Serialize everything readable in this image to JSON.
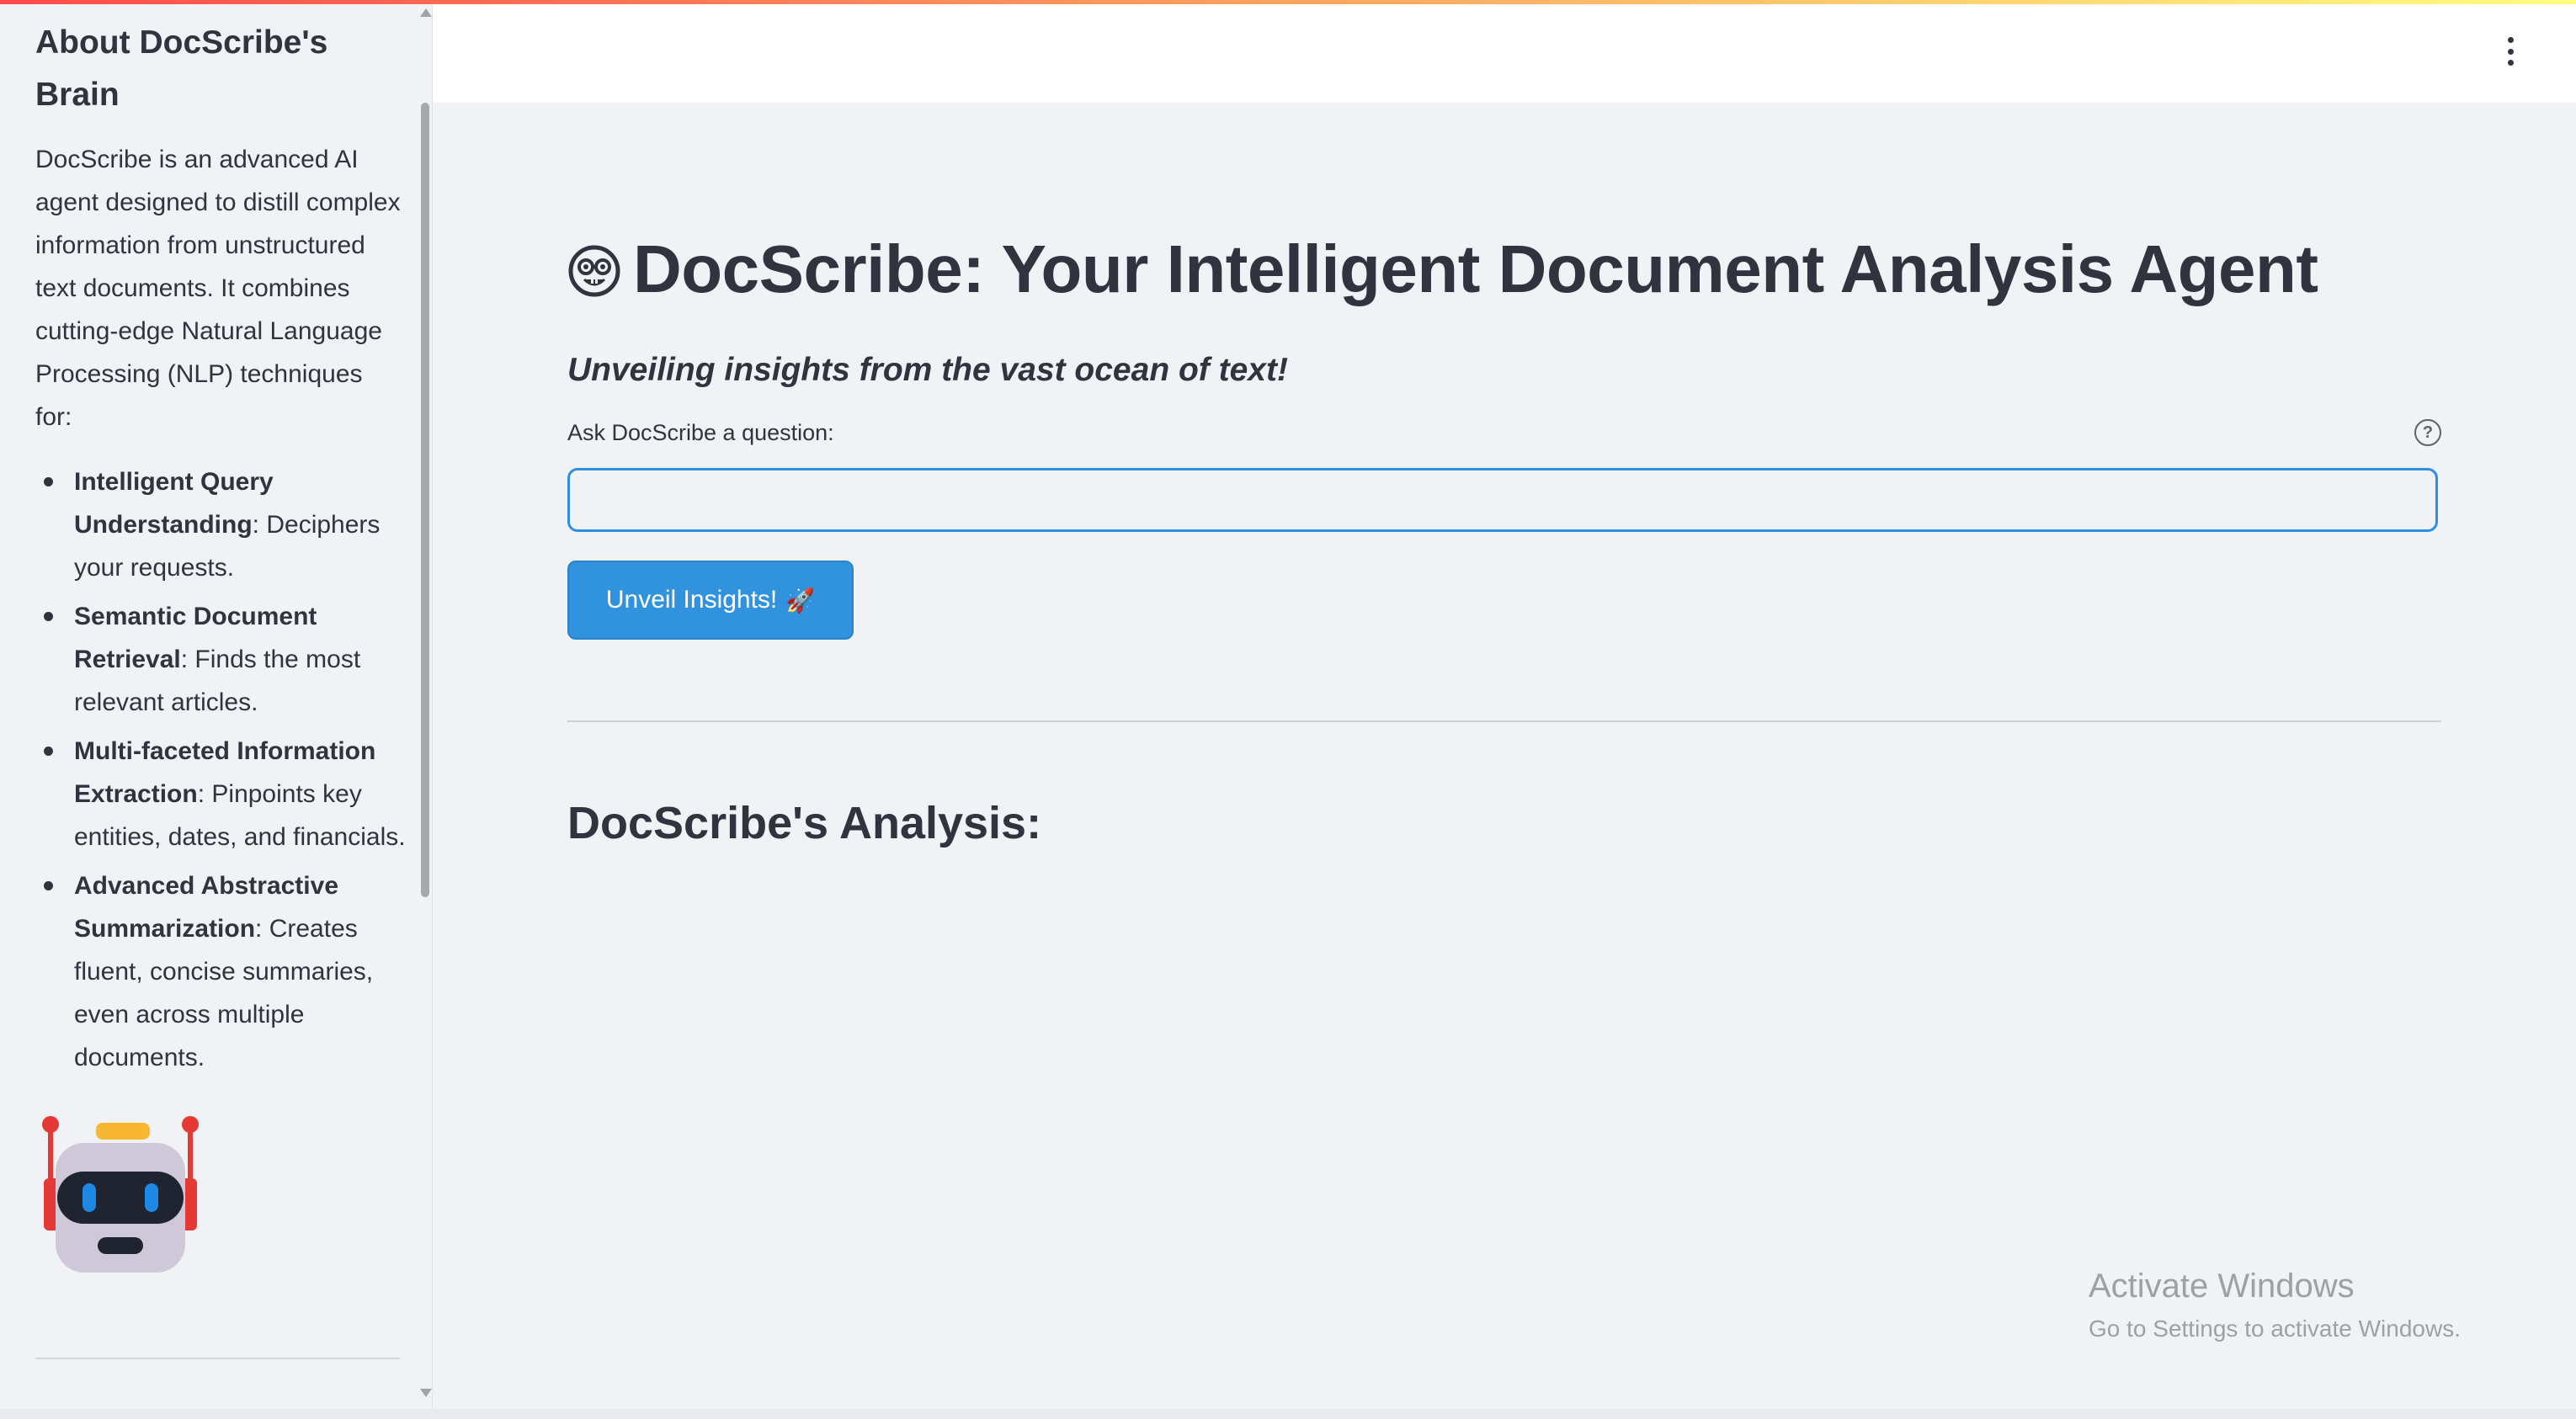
{
  "sidebar": {
    "title": "About DocScribe's Brain",
    "description": "DocScribe is an advanced AI agent designed to distill complex information from unstructured text documents. It combines cutting-edge Natural Language Processing (NLP) techniques for:",
    "features": [
      {
        "term": "Intelligent Query Understanding",
        "text": ": Deciphers your requests."
      },
      {
        "term": "Semantic Document Retrieval",
        "text": ": Finds the most relevant articles."
      },
      {
        "term": "Multi-faceted Information Extraction",
        "text": ": Pinpoints key entities, dates, and financials."
      },
      {
        "term": "Advanced Abstractive Summarization",
        "text": ": Creates fluent, concise summaries, even across multiple documents."
      }
    ],
    "image_icon": "robot-icon"
  },
  "header": {
    "menu_icon": "kebab-menu-icon"
  },
  "main": {
    "title_icon": "nerd-face-icon",
    "title": "DocScribe: Your Intelligent Document Analysis Agent",
    "subtitle": "Unveiling insights from the vast ocean of text!",
    "question_label": "Ask DocScribe a question:",
    "question_value": "",
    "help_icon": "question-circle-icon",
    "submit_label": "Unveil Insights!",
    "submit_emoji": "🚀",
    "analysis_heading": "DocScribe's Analysis:"
  },
  "watermark": {
    "title": "Activate Windows",
    "subtitle": "Go to Settings to activate Windows."
  },
  "colors": {
    "accent": "#3192dd",
    "background": "#f0f2f6",
    "text": "#31333f"
  }
}
